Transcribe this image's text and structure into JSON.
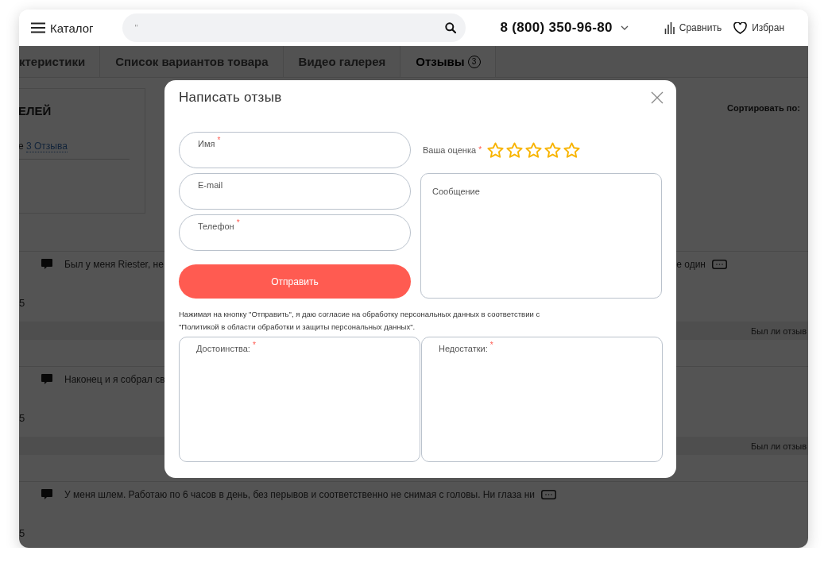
{
  "header": {
    "menu_label": "Каталог",
    "search": {
      "placeholder": "\""
    },
    "phone": "8 (800) 350-96-80",
    "compare": "Сравнить",
    "favorites": "Избран"
  },
  "tabs": [
    {
      "label": "ктеристики",
      "selected": false
    },
    {
      "label": "Список вариантов товара",
      "selected": false
    },
    {
      "label": "Видео галерея",
      "selected": false
    },
    {
      "label": "Отзывы",
      "count": "3",
      "selected": true
    }
  ],
  "summary": {
    "title": "ЕЛЕЙ",
    "text": "е",
    "link": "3 Отзыва"
  },
  "sort_label": "Сортировать по:",
  "reviews": [
    {
      "text": "Был у меня Riester, не",
      "text_end": "е один",
      "more": true,
      "rating": "5",
      "helpful_prompt": "Был ли отзыв"
    },
    {
      "text": "Наконец и я собрал св",
      "rating": "5",
      "helpful_prompt": "Был ли отзыв"
    },
    {
      "text": "У меня шлем. Работаю по 6 часов в день, без перывов и соответственно не снимая с головы. Ни глаза ни",
      "more": true,
      "rating": "5"
    }
  ],
  "modal": {
    "title": "Написать отзыв",
    "fields": [
      {
        "label": "Имя",
        "required": "*"
      },
      {
        "label": "E-mail"
      },
      {
        "label": "Телефон",
        "required": "*"
      }
    ],
    "submit": "Отправить",
    "rating": {
      "label": "Ваша оценка",
      "required": "*",
      "stars": 0
    },
    "message": {
      "placeholder": "Сообщение"
    },
    "consent": "Нажимая на кнопку \"Отправить\", я даю согласие на обработку персональных данных в соответствии с \"Политикой в области обработки и защиты персональных данных\".",
    "pros": {
      "label": "Достоинства:",
      "required": "*"
    },
    "cons": {
      "label": "Недостатки:",
      "required": "*"
    }
  }
}
